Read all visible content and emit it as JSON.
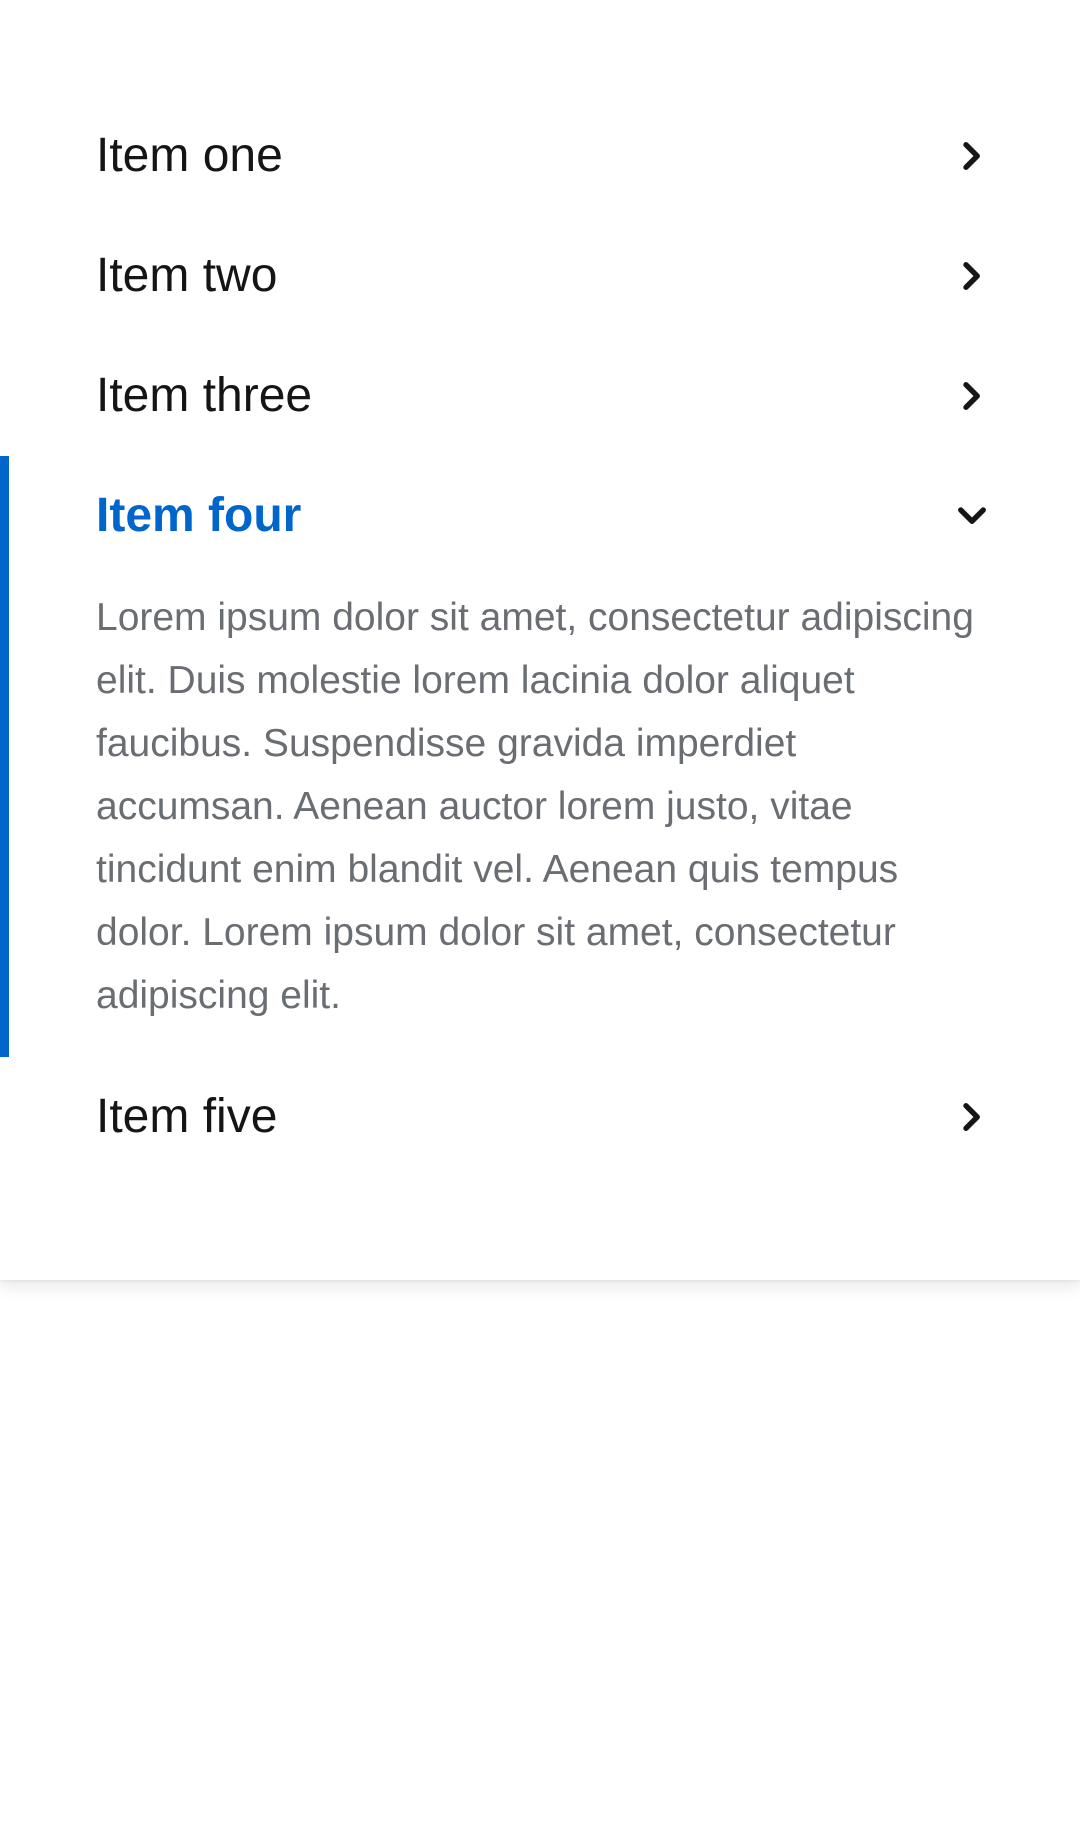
{
  "accordion": {
    "accent_color": "#0066cc",
    "items": [
      {
        "label": "Item one",
        "icon": "chevron-right-icon",
        "expanded": false
      },
      {
        "label": "Item two",
        "icon": "chevron-right-icon",
        "expanded": false
      },
      {
        "label": "Item three",
        "icon": "chevron-right-icon",
        "expanded": false
      },
      {
        "label": "Item four",
        "icon": "chevron-down-icon",
        "expanded": true,
        "content": "Lorem ipsum dolor sit amet, consectetur adipiscing elit. Duis molestie lorem lacinia dolor aliquet faucibus. Suspendisse gravida imperdiet accumsan. Aenean auctor lorem justo, vitae tincidunt enim blandit vel. Aenean quis tempus dolor. Lorem ipsum dolor sit amet, consectetur adipiscing elit."
      },
      {
        "label": "Item five",
        "icon": "chevron-right-icon",
        "expanded": false
      }
    ]
  }
}
